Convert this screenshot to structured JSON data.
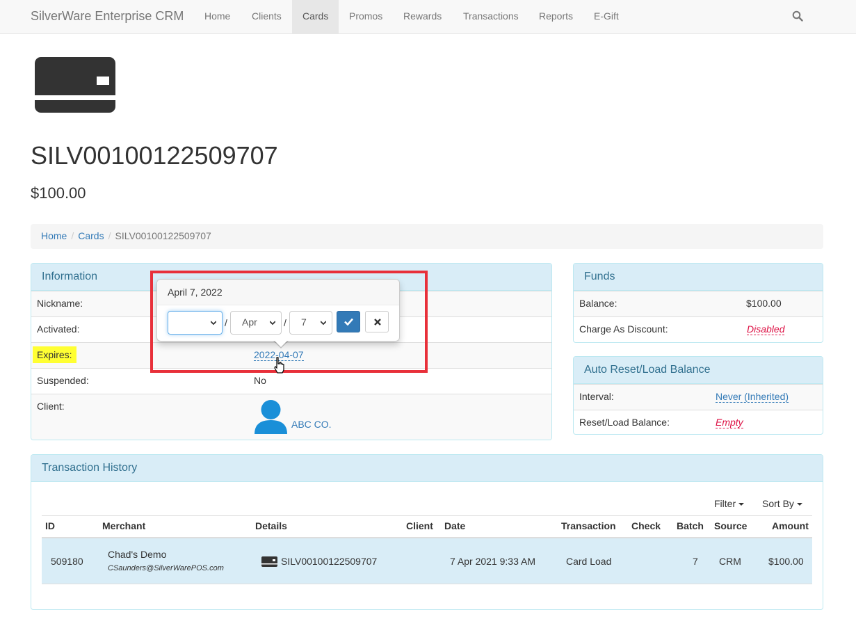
{
  "navbar": {
    "brand": "SilverWare Enterprise CRM",
    "items": [
      "Home",
      "Clients",
      "Cards",
      "Promos",
      "Rewards",
      "Transactions",
      "Reports",
      "E-Gift"
    ],
    "active": "Cards",
    "search_icon": "search-icon"
  },
  "card": {
    "icon": "credit-card-icon",
    "number": "SILV00100122509707",
    "balance": "$100.00"
  },
  "breadcrumb": [
    "Home",
    "Cards",
    "SILV00100122509707"
  ],
  "information": {
    "title": "Information",
    "nickname_label": "Nickname:",
    "activated_label": "Activated:",
    "expires_label": "Expires:",
    "expires_value": "2022-04-07",
    "suspended_label": "Suspended:",
    "suspended_value": "No",
    "client_label": "Client:",
    "client_value": "ABC CO.",
    "client_icon": "user-avatar-icon"
  },
  "date_popover": {
    "title": "April 7, 2022",
    "year_value": "",
    "month_value": "Apr",
    "day_value": "7",
    "separator": "/",
    "ok_icon": "check-icon",
    "cancel_icon": "close-icon"
  },
  "funds": {
    "title": "Funds",
    "balance_label": "Balance:",
    "balance_value": "$100.00",
    "discount_label": "Charge As Discount:",
    "discount_value": "Disabled"
  },
  "auto_reset": {
    "title": "Auto Reset/Load Balance",
    "interval_label": "Interval:",
    "interval_value": "Never (Inherited)",
    "reset_label": "Reset/Load Balance:",
    "reset_value": "Empty"
  },
  "transactions": {
    "title": "Transaction History",
    "filter_label": "Filter",
    "sort_label": "Sort By",
    "columns": {
      "id": "ID",
      "merchant": "Merchant",
      "details": "Details",
      "client": "Client",
      "date": "Date",
      "transaction": "Transaction",
      "check": "Check",
      "batch": "Batch",
      "source": "Source",
      "amount": "Amount"
    },
    "rows": [
      {
        "id": "509180",
        "merchant": "Chad's Demo",
        "merchant_email": "CSaunders@SilverWarePOS.com",
        "details_icon": "card-icon",
        "details": "SILV00100122509707",
        "client": "",
        "date": "7 Apr 2021 9:33 AM",
        "transaction": "Card Load",
        "check": "",
        "batch": "7",
        "source": "CRM",
        "amount": "$100.00"
      }
    ]
  },
  "colors": {
    "accent": "#337ab7",
    "panel_heading": "#d9edf7",
    "highlight": "#ffff33",
    "annotation_box": "#e8303a",
    "empty_value": "#dd1144"
  }
}
